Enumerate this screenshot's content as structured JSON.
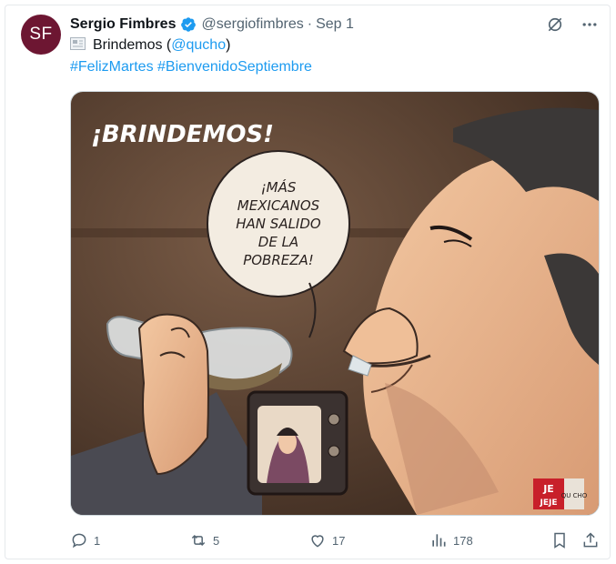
{
  "author": {
    "avatar_initials": "SF",
    "name": "Sergio Fimbres",
    "handle": "@sergiofimbres",
    "separator": "·",
    "date": "Sep 1",
    "avatar_color": "#6d1632"
  },
  "tweet": {
    "text_word": "Brindemos",
    "text_open": " (",
    "mention": "@qucho",
    "text_close": ")",
    "hashtags": "#FelizMartes #BienvenidoSeptiembre"
  },
  "cartoon": {
    "title": "¡BRINDEMOS!",
    "speech_lines": [
      "¡MÁS",
      "MEXICANOS",
      "HAN SALIDO",
      "DE LA",
      "POBREZA!"
    ],
    "signature_top": "JE",
    "signature_bottom": "JEJE",
    "signature_side": "QU CHO"
  },
  "actions": {
    "replies": "1",
    "reposts": "5",
    "likes": "17",
    "views": "178"
  },
  "colors": {
    "link": "#1d9bf0",
    "muted": "#536471",
    "verified": "#1d9bf0",
    "cartoon_bg": "#5a4232"
  },
  "icons": [
    "verified-icon",
    "grok-icon",
    "more-icon",
    "document-emoji-icon",
    "reply-icon",
    "repost-icon",
    "like-icon",
    "views-icon",
    "bookmark-icon",
    "share-icon"
  ]
}
